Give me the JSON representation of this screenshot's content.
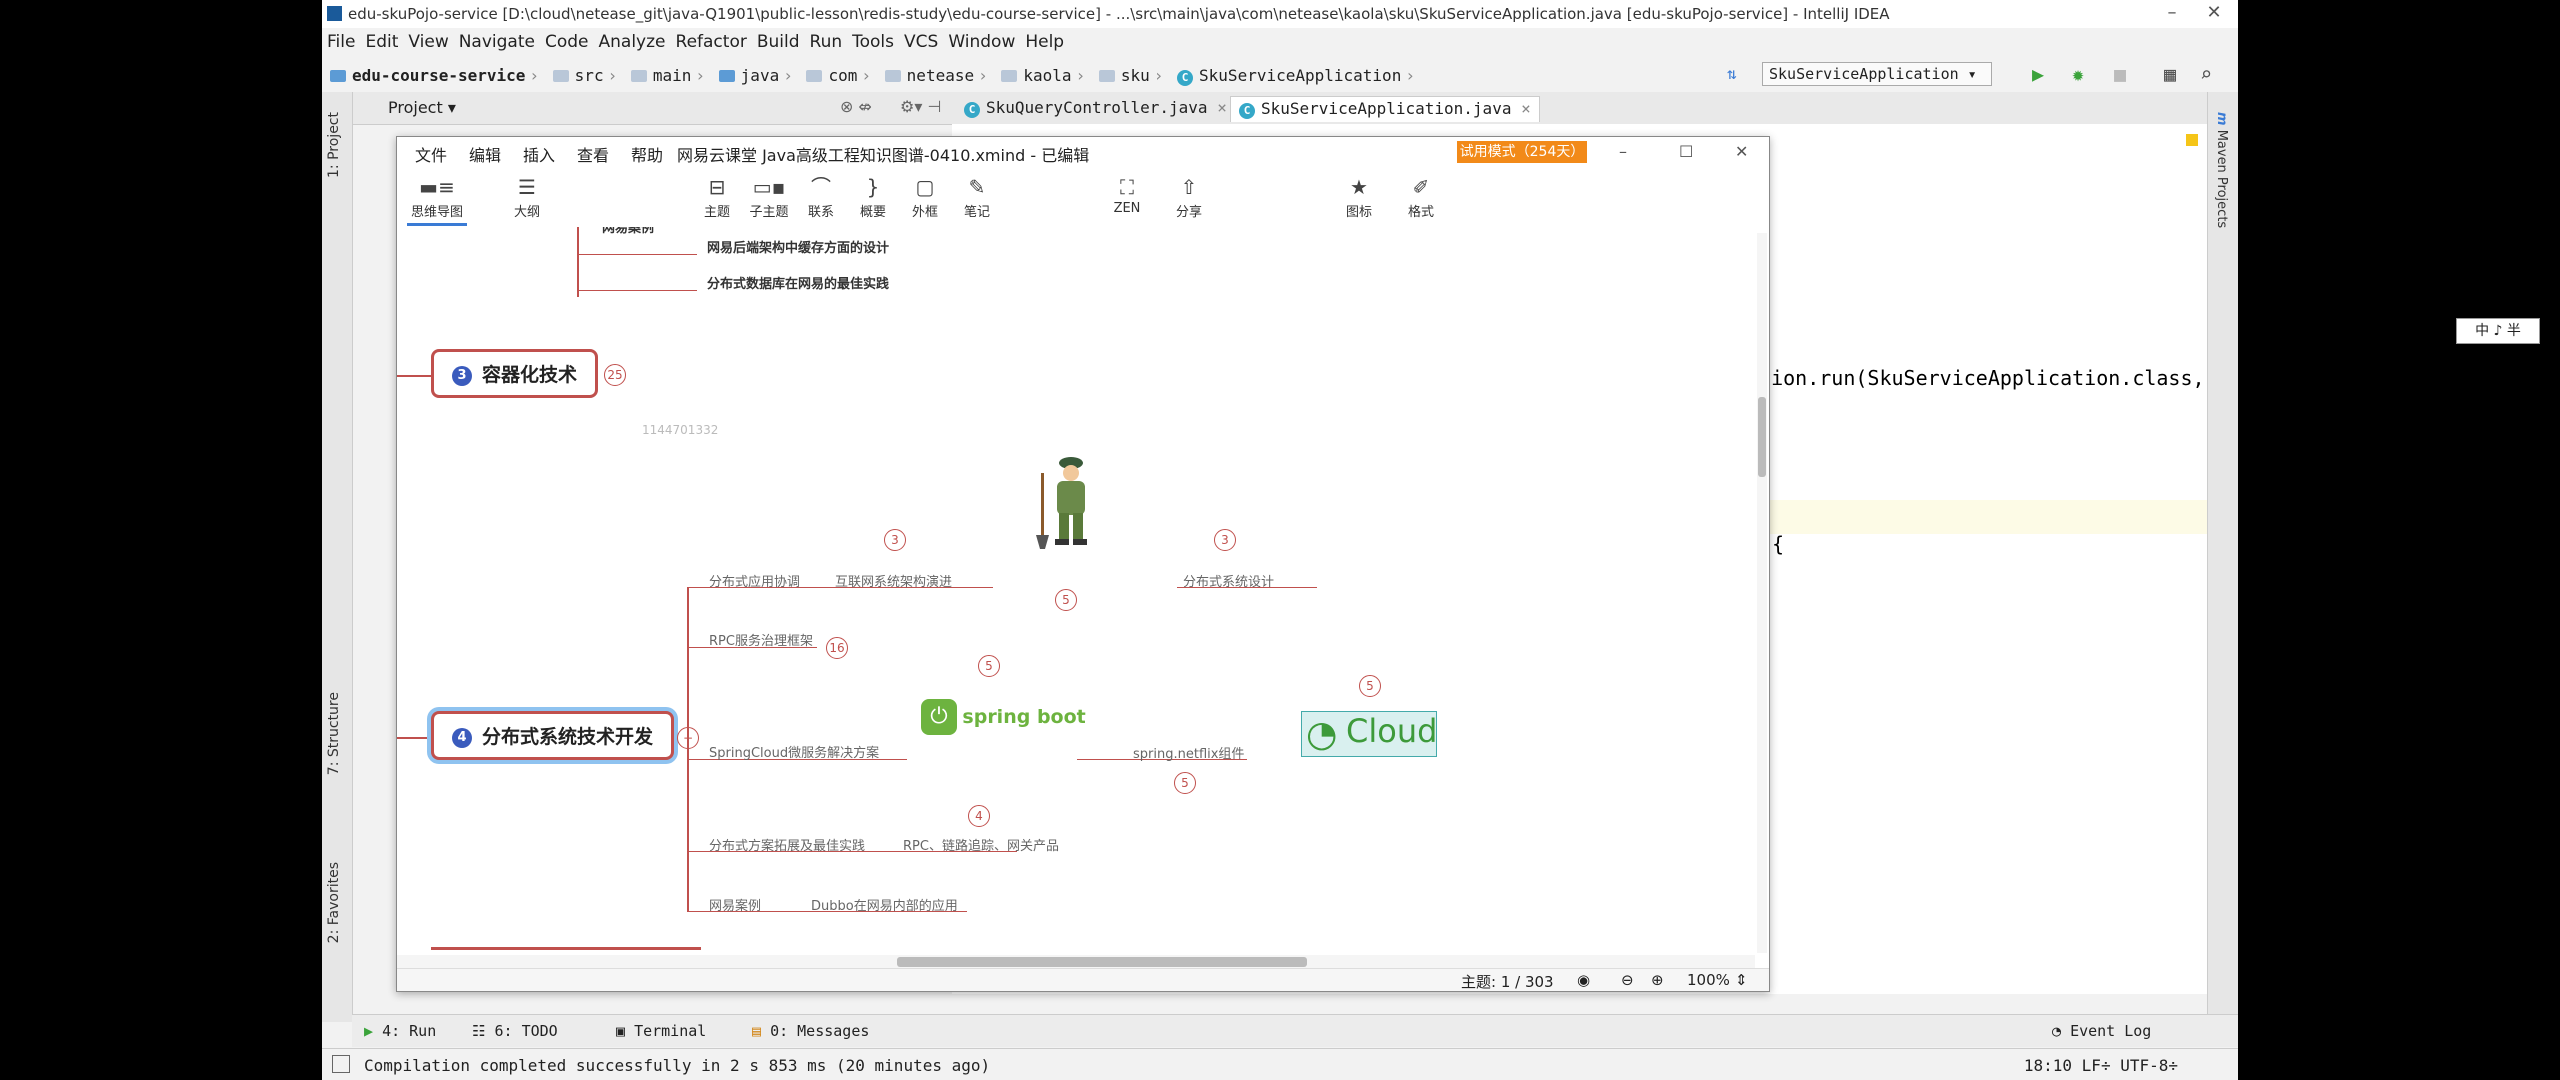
{
  "ide": {
    "title": "edu-skuPojo-service [D:\\cloud\\netease_git\\java-Q1901\\public-lesson\\redis-study\\edu-course-service] - ...\\src\\main\\java\\com\\netease\\kaola\\sku\\SkuServiceApplication.java [edu-skuPojo-service] - IntelliJ IDEA",
    "menu": [
      "File",
      "Edit",
      "View",
      "Navigate",
      "Code",
      "Analyze",
      "Refactor",
      "Build",
      "Run",
      "Tools",
      "VCS",
      "Window",
      "Help"
    ],
    "breadcrumb": [
      "edu-course-service",
      "src",
      "main",
      "java",
      "com",
      "netease",
      "kaola",
      "sku",
      "SkuServiceApplication"
    ],
    "run_config": "SkuServiceApplication",
    "project_label": "Project",
    "tabs": [
      "SkuQueryController.java",
      "SkuServiceApplication.java"
    ],
    "code_line": "ation.run(SkuServiceApplication.class,",
    "code_brace": "{",
    "left_tabs": [
      "1: Project",
      "7: Structure",
      "2: Favorites"
    ],
    "right_tabs": [
      "Maven Projects"
    ],
    "bottom_tabs": [
      "4: Run",
      "6: TODO",
      "Terminal",
      "0: Messages"
    ],
    "event_log": "Event Log",
    "status_message": "Compilation completed successfully in 2 s 853 ms (20 minutes ago)",
    "status_right": "18:10  LF÷  UTF-8÷",
    "ime": "中 ♪ 半"
  },
  "xmind": {
    "menu": [
      "文件",
      "编辑",
      "插入",
      "查看",
      "帮助"
    ],
    "title": "网易云课堂 Java高级工程知识图谱-0410.xmind - 已编辑",
    "trial": "试用模式（254天）",
    "tools": [
      {
        "label": "思维导图",
        "icon": "mindmap-icon"
      },
      {
        "label": "大纲",
        "icon": "outline-icon"
      },
      {
        "label": "主题",
        "icon": "topic-icon"
      },
      {
        "label": "子主题",
        "icon": "subtopic-icon"
      },
      {
        "label": "联系",
        "icon": "relationship-icon"
      },
      {
        "label": "概要",
        "icon": "summary-icon"
      },
      {
        "label": "外框",
        "icon": "boundary-icon"
      },
      {
        "label": "笔记",
        "icon": "note-icon"
      },
      {
        "label": "ZEN",
        "icon": "zen-icon"
      },
      {
        "label": "分享",
        "icon": "share-icon"
      },
      {
        "label": "图标",
        "icon": "marker-icon"
      },
      {
        "label": "格式",
        "icon": "format-icon"
      }
    ],
    "top_items": [
      "网易案例",
      "网易后端架构中缓存方面的设计",
      "分布式数据库在网易的最佳实践"
    ],
    "topic3": {
      "num": "3",
      "label": "容器化技术",
      "count": "25"
    },
    "watermark": "1144701332",
    "topic4": {
      "num": "4",
      "label": "分布式系统技术开发"
    },
    "branches": {
      "coordination": "分布式应用协调",
      "evolution": "互联网系统架构演进",
      "design": "分布式系统设计",
      "rpc": "RPC服务治理框架",
      "springcloud": "SpringCloud微服务解决方案",
      "netflix": "spring.netflix组件",
      "expansion": "分布式方案拓展及最佳实践",
      "rpc_trace": "RPC、链路追踪、网关产品",
      "case": "网易案例",
      "dubbo": "Dubbo在网易内部的应用"
    },
    "badges": {
      "evolution": "3",
      "design": "3",
      "soldier": "5",
      "rpc": "16",
      "springboot": "5",
      "cloud": "5",
      "netflix": "5",
      "rpc_trace": "4"
    },
    "springboot_label": "spring boot",
    "cloud_label": "Cloud",
    "status_topics": "主题: 1 / 303",
    "zoom": "100%"
  },
  "colors": {
    "accent": "#c0504d",
    "trial": "#f28a19",
    "springboot": "#6db33f"
  }
}
